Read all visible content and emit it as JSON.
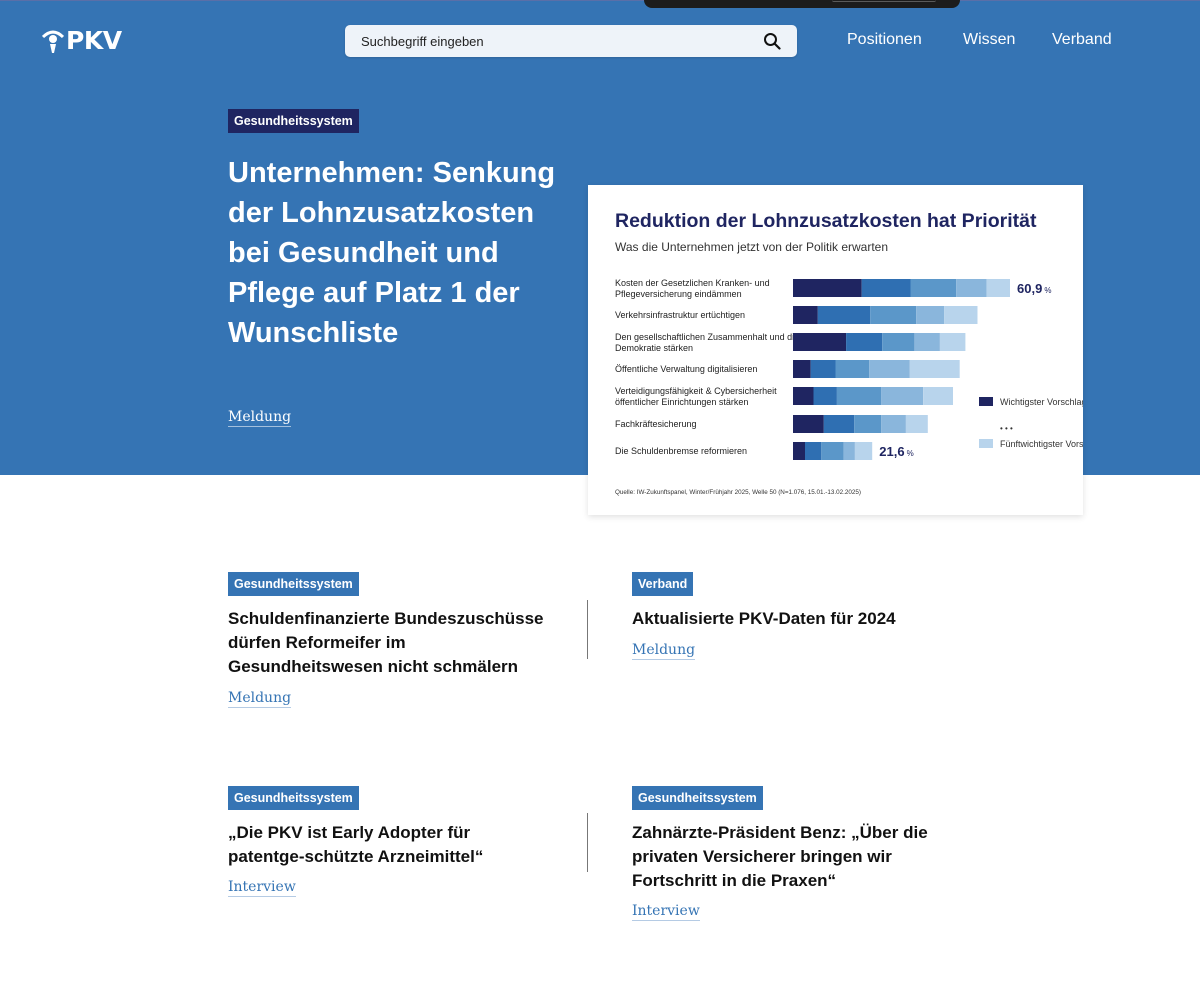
{
  "header": {
    "logo_text": "PKV",
    "search_placeholder": "Suchbegriff eingeben",
    "nav": [
      "Positionen",
      "Wissen",
      "Verband"
    ]
  },
  "hero": {
    "badge": "Gesundheitssystem",
    "title": "Unternehmen: Senkung der Lohnzusatzkosten bei Gesundheit und Pflege auf Platz 1 der Wunschliste",
    "link": "Meldung"
  },
  "chart_data": {
    "type": "bar",
    "stacked": true,
    "orientation": "horizontal",
    "title": "Reduktion der Lohnzusatzkosten hat Priorität",
    "subtitle": "Was die Unternehmen jetzt von der Politik erwarten",
    "categories": [
      "Kosten der Gesetzlichen Kranken- und Pflegeversicherung eindämmen",
      "Verkehrsinfrastruktur ertüchtigen",
      "Den gesellschaftlichen Zusammenhalt und die Demokratie stärken",
      "Öffentliche Verwaltung digitalisieren",
      "Verteidigungsfähigkeit & Cybersicherheit öffentlicher Einrichtungen stärken",
      "Fachkräftesicherung",
      "Die Schuldenbremse reformieren"
    ],
    "series": [
      {
        "name": "Wichtigster Vorschlag",
        "values": [
          19.4,
          7.0,
          15.0,
          5.0,
          5.8,
          8.7,
          3.4
        ]
      },
      {
        "values": [
          13.8,
          14.8,
          10.2,
          7.0,
          6.6,
          8.6,
          4.6
        ]
      },
      {
        "values": [
          12.9,
          13.0,
          9.1,
          9.5,
          12.5,
          7.6,
          6.3
        ]
      },
      {
        "values": [
          8.6,
          7.9,
          7.2,
          11.5,
          11.9,
          7.0,
          3.2
        ]
      },
      {
        "name": "Fünftwichtigster Vorschlag",
        "values": [
          6.6,
          9.4,
          7.2,
          14.1,
          8.4,
          6.2,
          4.9
        ]
      }
    ],
    "value_labels": [
      {
        "category": "Kosten der Gesetzlichen Kranken- und Pflegeversicherung eindämmen",
        "value": "60,9",
        "unit": "%"
      },
      {
        "category": "Die Schuldenbremse reformieren",
        "value": "21,6",
        "unit": "%"
      }
    ],
    "legend": {
      "top": "Wichtigster Vorschlag",
      "ellipsis": "• • •",
      "bottom": "Fünftwichtigster Vorschlag",
      "placement": "right"
    },
    "source": "Quelle: IW-Zukunftspanel, Winter/Frühjahr 2025, Welle 50 (N=1.076, 15.01.-13.02.2025)",
    "colors": [
      "#1f2561",
      "#2f6fb2",
      "#5b97c9",
      "#8ab6dc",
      "#b8d4ec"
    ],
    "xlim": [
      0,
      65
    ]
  },
  "cards": [
    {
      "badge": "Gesundheitssystem",
      "title": "Schuldenfinanzierte Bundeszuschüsse dürfen Reformeifer im Gesundheitswesen nicht schmälern",
      "link": "Meldung"
    },
    {
      "badge": "Verband",
      "title": "Aktualisierte PKV-Daten für 2024",
      "link": "Meldung"
    },
    {
      "badge": "Gesundheitssystem",
      "title": "„Die PKV ist Early Adopter für patentge-schützte Arzneimittel“",
      "link": "Interview"
    },
    {
      "badge": "Gesundheitssystem",
      "title": "Zahnärzte-Präsident Benz: „Über die privaten Versicherer bringen wir Fortschritt in die Praxen“",
      "link": "Interview"
    }
  ],
  "colors": {
    "hero_blue": "#3574b4",
    "badge_dark": "#1f2561",
    "chart_title": "#1f2561"
  }
}
